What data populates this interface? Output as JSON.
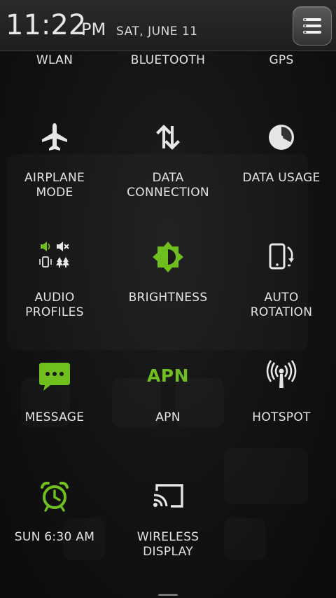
{
  "status": {
    "time": "11:22",
    "ampm": "PM",
    "date": "SAT, JUNE 11",
    "menu_icon": "menu-lines-icon"
  },
  "top_row": [
    {
      "label": "WLAN"
    },
    {
      "label": "BLUETOOTH"
    },
    {
      "label": "GPS"
    }
  ],
  "tiles": [
    {
      "label": "AIRPLANE\nMODE",
      "icon": "airplane-icon",
      "color": "#e6e6e6"
    },
    {
      "label": "DATA\nCONNECTION",
      "icon": "data-transfer-icon",
      "color": "#e6e6e6"
    },
    {
      "label": "DATA USAGE",
      "icon": "clock-pie-icon",
      "color": "#e6e6e6"
    },
    {
      "label": "AUDIO\nPROFILES",
      "icon": "audio-profiles-icon",
      "color": "#6fbf1f"
    },
    {
      "label": "BRIGHTNESS",
      "icon": "brightness-icon",
      "color": "#6fbf1f"
    },
    {
      "label": "AUTO\nROTATION",
      "icon": "auto-rotation-icon",
      "color": "#e6e6e6"
    },
    {
      "label": "MESSAGE",
      "icon": "message-bubble-icon",
      "color": "#6fbf1f"
    },
    {
      "label": "APN",
      "icon": "apn-text-icon",
      "icon_text": "APN",
      "color": "#6fbf1f"
    },
    {
      "label": "HOTSPOT",
      "icon": "hotspot-icon",
      "color": "#e6e6e6"
    },
    {
      "label": "SUN 6:30 AM",
      "icon": "alarm-clock-icon",
      "color": "#6fbf1f"
    },
    {
      "label": "WIRELESS\nDISPLAY",
      "icon": "cast-screen-icon",
      "color": "#e6e6e6"
    }
  ],
  "colors": {
    "accent_green": "#6fbf1f",
    "label_text": "#e4e4e4",
    "header_bg": "#262626"
  }
}
